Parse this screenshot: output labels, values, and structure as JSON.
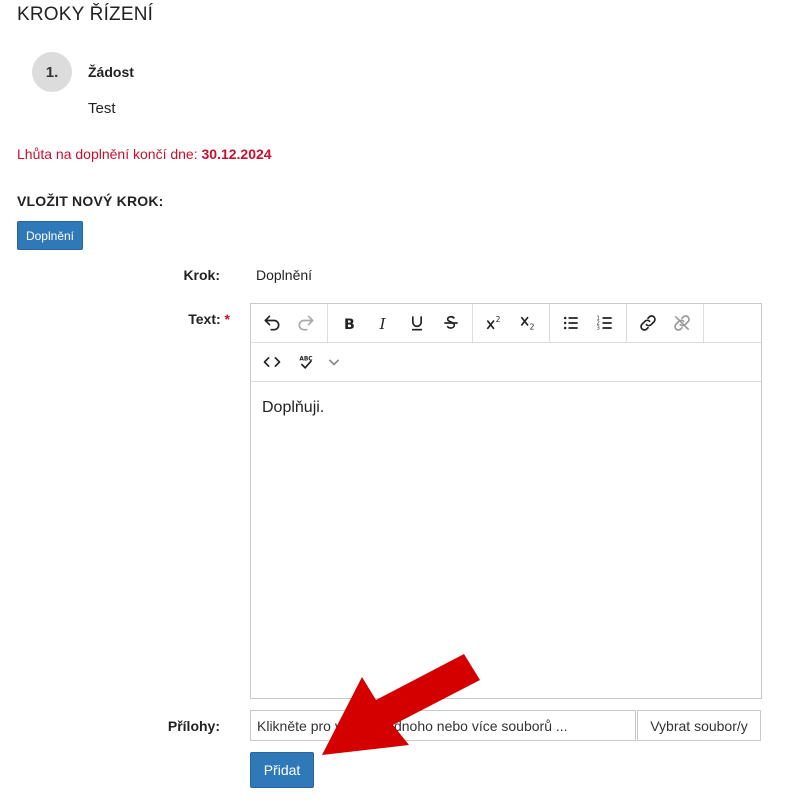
{
  "section_title": "KROKY ŘÍZENÍ",
  "step": {
    "number": "1.",
    "name": "Žádost",
    "description": "Test"
  },
  "deadline": {
    "prefix": "Lhůta na doplnění končí dne: ",
    "date": "30.12.2024"
  },
  "insert_title": "VLOŽIT NOVÝ KROK:",
  "doplneni_button": "Doplnění",
  "form": {
    "krok_label": "Krok:",
    "krok_value": "Doplnění",
    "text_label": "Text:",
    "required_mark": "*",
    "editor_content": "Doplňuji.",
    "prilohy_label": "Přílohy:",
    "file_placeholder": "Klikněte pro vložení jednoho nebo více souborů ...",
    "file_button": "Vybrat soubor/y",
    "submit_button": "Přidat"
  },
  "toolbar": {
    "row1": [
      "undo-icon",
      "redo-icon",
      "bold-icon",
      "italic-icon",
      "underline-icon",
      "strikethrough-icon",
      "superscript-icon",
      "subscript-icon",
      "bullet-list-icon",
      "numbered-list-icon",
      "link-icon",
      "unlink-icon"
    ],
    "row2": [
      "source-code-icon",
      "spellcheck-icon",
      "chevron-down-icon"
    ]
  },
  "colors": {
    "accent": "#2f79b9",
    "deadline": "#c8102e",
    "arrow": "#d40000"
  }
}
